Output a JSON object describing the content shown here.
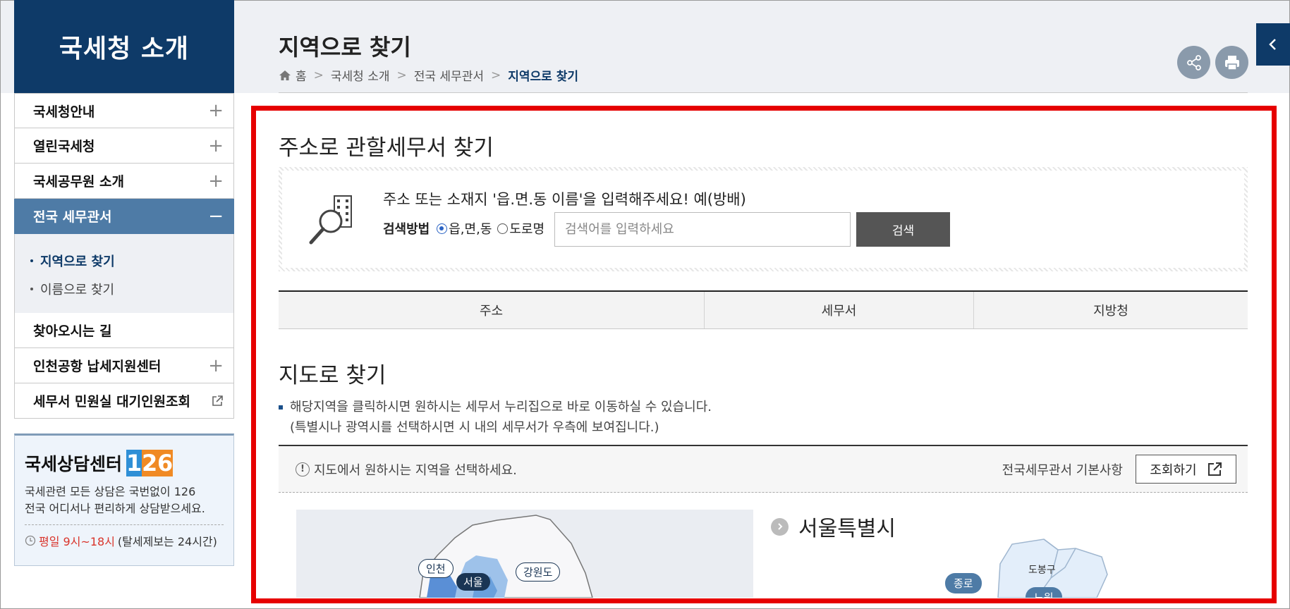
{
  "sidebar": {
    "title": "국세청 소개",
    "menu": [
      {
        "label": "국세청안내",
        "icon": "plus-icon"
      },
      {
        "label": "열린국세청",
        "icon": "plus-icon"
      },
      {
        "label": "국세공무원 소개",
        "icon": "plus-icon"
      },
      {
        "label": "전국 세무관서",
        "icon": "minus-icon",
        "active": true
      },
      {
        "label": "찾아오시는 길"
      },
      {
        "label": "인천공항 납세지원센터",
        "icon": "plus-icon"
      },
      {
        "label": "세무서 민원실 대기인원조회",
        "icon": "external-link-icon"
      }
    ],
    "submenu": [
      {
        "label": "지역으로 찾기",
        "active": true
      },
      {
        "label": "이름으로 찾기"
      }
    ],
    "consult": {
      "title": "국세상담센터",
      "number_digits": [
        "1",
        "2",
        "6"
      ],
      "digit_colors": [
        "#2f8fd6",
        "#f08a24",
        "#f08a24"
      ],
      "desc_line1": "국세관련 모든 상담은 국번없이 126",
      "desc_line2": "전국 어디서나 편리하게 상담받으세요.",
      "hours": "평일 9시~18시",
      "hours_note": "(탈세제보는 24시간)"
    }
  },
  "header": {
    "title": "지역으로 찾기",
    "breadcrumb": [
      "홈",
      "국세청 소개",
      "전국 세무관서",
      "지역으로 찾기"
    ]
  },
  "search_section": {
    "title": "주소로 관할세무서 찾기",
    "guide": "주소 또는 소재지 '읍.면.동 이름'을 입력해주세요! 예(방배)",
    "method_label": "검색방법",
    "options": [
      "읍,면,동",
      "도로명"
    ],
    "selected_option": "읍,면,동",
    "input_value": "",
    "input_placeholder": "검색어를 입력하세요",
    "button_label": "검색"
  },
  "result_table": {
    "columns": [
      "주소",
      "세무서",
      "지방청"
    ]
  },
  "map_section": {
    "title": "지도로 찾기",
    "desc_line1": "해당지역을 클릭하시면 원하시는 세무서 누리집으로 바로 이동하실 수 있습니다.",
    "desc_line2": "(특별시나 광역시를 선택하시면 시 내의 세무서가 우측에 보여집니다.)",
    "bar_text": "지도에서 원하시는 지역을 선택하세요.",
    "bar_right_text": "전국세무관서 기본사항",
    "lookup_button": "조회하기",
    "map_labels": [
      "인천",
      "서울",
      "강원도"
    ],
    "region_title": "서울특별시",
    "district_labels": [
      "도봉구",
      "종로",
      "노원"
    ]
  },
  "colors": {
    "navy": "#0e3a68",
    "active_menu": "#4e7ba6",
    "highlight_frame": "#e60000"
  }
}
